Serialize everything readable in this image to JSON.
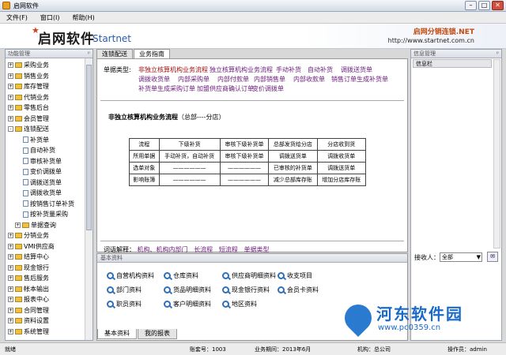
{
  "window": {
    "title": "启网软件"
  },
  "menu": [
    "文件(F)",
    "窗口(I)",
    "帮助(H)"
  ],
  "banner": {
    "logo_cn": "启网软件",
    "logo_en": "Startnet",
    "slogan": "启网分销连锁.NET",
    "url": "http://www.startnet.com.cn"
  },
  "left_panel": {
    "header": "功能管理",
    "items": [
      {
        "label": "采购业务",
        "type": "folder",
        "expand": "+"
      },
      {
        "label": "销售业务",
        "type": "folder",
        "expand": "+"
      },
      {
        "label": "库存管理",
        "type": "folder",
        "expand": "+"
      },
      {
        "label": "代销业务",
        "type": "folder",
        "expand": "+"
      },
      {
        "label": "零售后台",
        "type": "folder",
        "expand": "+"
      },
      {
        "label": "会员管理",
        "type": "folder",
        "expand": "+"
      },
      {
        "label": "连锁配送",
        "type": "folder",
        "expand": "-"
      },
      {
        "label": "补货单",
        "type": "doc"
      },
      {
        "label": "自动补货",
        "type": "doc"
      },
      {
        "label": "审核补货单",
        "type": "doc"
      },
      {
        "label": "变价调拨单",
        "type": "doc"
      },
      {
        "label": "调拨送货单",
        "type": "doc"
      },
      {
        "label": "调拨收货单",
        "type": "doc"
      },
      {
        "label": "按销售订单补货",
        "type": "doc"
      },
      {
        "label": "按补货量采购",
        "type": "doc"
      },
      {
        "label": "单据查询",
        "type": "folder",
        "expand": "+",
        "indent": 1
      },
      {
        "label": "分销业务",
        "type": "folder",
        "expand": "+"
      },
      {
        "label": "VMI供应商",
        "type": "folder",
        "expand": "+"
      },
      {
        "label": "结算中心",
        "type": "folder",
        "expand": "+"
      },
      {
        "label": "现金银行",
        "type": "folder",
        "expand": "+"
      },
      {
        "label": "售后服务",
        "type": "folder",
        "expand": "+"
      },
      {
        "label": "帐本输出",
        "type": "folder",
        "expand": "+"
      },
      {
        "label": "报表中心",
        "type": "folder",
        "expand": "+"
      },
      {
        "label": "合同管理",
        "type": "folder",
        "expand": "+"
      },
      {
        "label": "资料设置",
        "type": "folder",
        "expand": "+"
      },
      {
        "label": "系统管理",
        "type": "folder",
        "expand": "+"
      }
    ]
  },
  "center": {
    "tabs": [
      "连锁配送",
      "业务指南"
    ],
    "biz_label": "单据类型:",
    "biz_rows": [
      [
        "非独立核算机构业务流程",
        "独立核算机构业务流程",
        "手动补货",
        "自动补货",
        "调拨送货单"
      ],
      [
        "调拨收货单",
        "内部采购单",
        "内部付款单",
        "内部销售单",
        "内部收款单",
        "销售订单生成补货单"
      ],
      [
        "补货单生成采购订单",
        "加盟供应商确认订单",
        "变价调拨单"
      ]
    ],
    "flow_title": "非独立核算机构业务流程",
    "flow_subtitle": "（总部----分店）",
    "flow_table": [
      [
        "流程",
        "下级补货",
        "审核下级补货单",
        "总部发货给分店",
        "分店收到货"
      ],
      [
        "所用单据",
        "手动补货，自动补货",
        "审核下级补货单",
        "调拨送货单",
        "调拨收货单"
      ],
      [
        "选单对象",
        "——————",
        "——————",
        "已审核的补货单",
        "调拨送货单"
      ],
      [
        "影响账簿",
        "——————",
        "——————",
        "减少总部库存账",
        "增加分店库存账"
      ]
    ],
    "glossary_label": "词语解释：",
    "glossary": [
      "机构、机构内部门",
      "长流程",
      "短流程",
      "单据类型"
    ],
    "basic_header": "基本资料",
    "basic_items": [
      "自营机构资料",
      "仓库资料",
      "供应商明细资料",
      "收支项目",
      "部门资料",
      "货品明细资料",
      "现金银行资料",
      "会员卡资料",
      "职员资料",
      "客户明细资料",
      "地区资料"
    ],
    "bottom_tabs": [
      "基本资料",
      "我的报表"
    ]
  },
  "right_panel": {
    "header": "信息管理",
    "info_bar": "信息栏",
    "recv_label": "接收人：",
    "recv_value": "全部"
  },
  "status": {
    "state": "就绪",
    "account": "账套号：1003",
    "period": "业务期间：2013年6月",
    "org": "机构：总公司",
    "operator": "操作员：admin"
  },
  "watermark": {
    "cn": "河东软件园",
    "en": "www.pc0359.cn"
  }
}
